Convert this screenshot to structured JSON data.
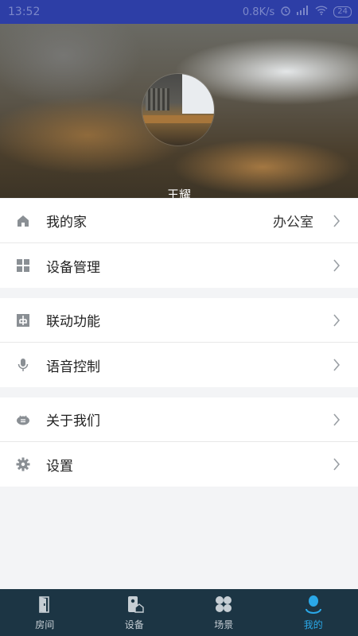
{
  "status_bar": {
    "time": "13:52",
    "network_speed": "0.8K/s",
    "battery": "24"
  },
  "profile": {
    "username": "王耀"
  },
  "menu_groups": [
    {
      "items": [
        {
          "label": "我的家",
          "value": "办公室",
          "icon": "home-icon"
        },
        {
          "label": "设备管理",
          "icon": "grid-icon"
        }
      ]
    },
    {
      "items": [
        {
          "label": "联动功能",
          "icon": "linkage-icon"
        },
        {
          "label": "语音控制",
          "icon": "microphone-icon"
        }
      ]
    },
    {
      "items": [
        {
          "label": "关于我们",
          "icon": "bee-icon"
        },
        {
          "label": "设置",
          "icon": "gear-icon"
        }
      ]
    }
  ],
  "bottom_nav": {
    "tabs": [
      {
        "label": "房间",
        "icon": "door-icon"
      },
      {
        "label": "设备",
        "icon": "device-icon"
      },
      {
        "label": "场景",
        "icon": "scene-icon"
      },
      {
        "label": "我的",
        "icon": "user-icon",
        "active": true
      }
    ]
  },
  "colors": {
    "status_bar": "#2d3ea6",
    "bottom_nav": "#1c3544",
    "accent": "#2aa8e8",
    "page_bg": "#f3f4f6"
  }
}
